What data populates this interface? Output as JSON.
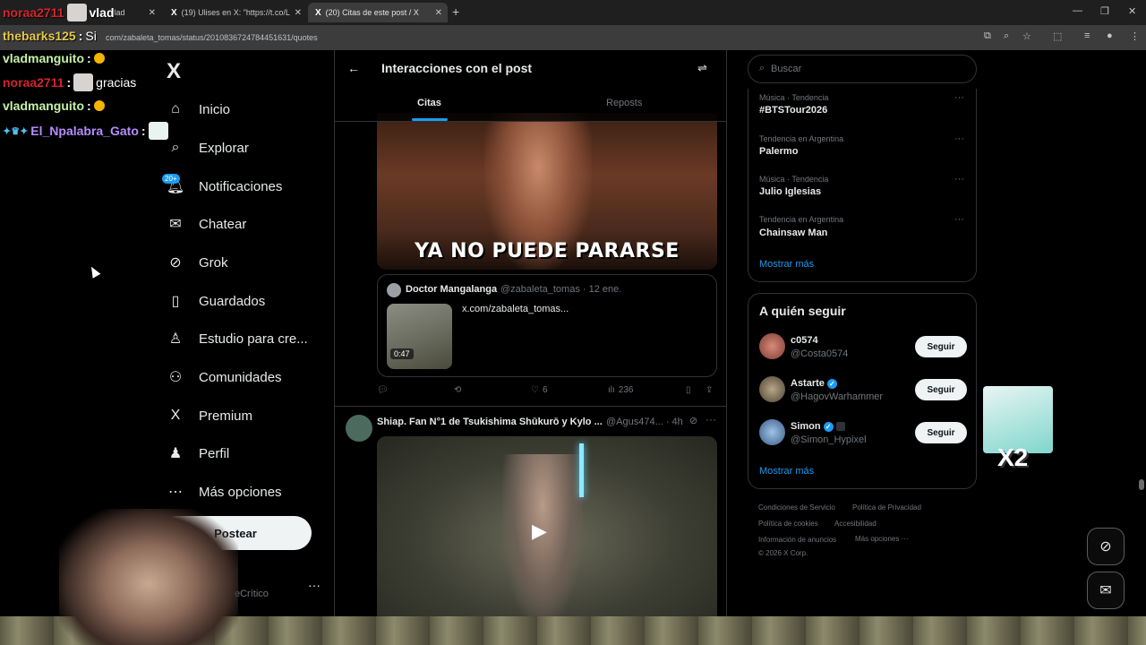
{
  "browser": {
    "tabs": [
      {
        "label": "vlad",
        "active": false
      },
      {
        "label": "(19) Ulises en X: \"https://t.co/L",
        "active": false
      },
      {
        "label": "(20) Citas de este post / X",
        "active": true
      }
    ],
    "url": "com/zabaleta_tomas/status/2010836724784451631/quotes"
  },
  "chat": [
    {
      "user": "noraa2711",
      "color": "#d6232f",
      "message": "",
      "emote": "vlad-emote"
    },
    {
      "user": "thebarks125",
      "color": "#e6c84a",
      "message": "Si",
      "emote": ""
    },
    {
      "user": "vladmanguito",
      "color": "#c7f1a5",
      "message": "",
      "emote": "mango"
    },
    {
      "user": "noraa2711",
      "color": "#d6232f",
      "message": "gracias",
      "emote": "vlad-emote"
    },
    {
      "user": "vladmanguito",
      "color": "#c7f1a5",
      "message": "",
      "emote": "mango"
    },
    {
      "user": "El_Npalabra_Gato",
      "color": "#b68cff",
      "message": "",
      "emote": "cat-emote"
    }
  ],
  "nav": {
    "items": [
      "Inicio",
      "Explorar",
      "Notificaciones",
      "Chatear",
      "Grok",
      "Guardados",
      "Estudio para cre...",
      "Comunidades",
      "Premium",
      "Perfil",
      "Más opciones"
    ],
    "icons": [
      "home-icon",
      "search-icon",
      "bell-icon",
      "mail-icon",
      "grok-icon",
      "bookmark-icon",
      "studio-icon",
      "communities-icon",
      "x-premium-icon",
      "person-icon",
      "more-circle-icon"
    ],
    "notif_badge": "20+",
    "post_button": "Postear",
    "account_name": "eCrítico"
  },
  "main": {
    "title": "Interacciones con el post",
    "tabs": [
      "Citas",
      "Reposts"
    ],
    "gif_caption": "YA NO PUEDE PARARSE",
    "quoted": {
      "name": "Doctor Mangalanga",
      "handle": "@zabaleta_tomas · 12 ene.",
      "link": "x.com/zabaleta_tomas...",
      "duration": "0:47"
    },
    "actions": {
      "likes": "6",
      "views": "236"
    },
    "post2": {
      "name": "Shiap. Fan N°1 de Tsukishima Shūkurō y Kylo ...",
      "handle": "@Agus474... · 4h"
    }
  },
  "sidebar": {
    "search_placeholder": "Buscar",
    "trends": [
      {
        "category": "Música · Tendencia",
        "name": "#BTSTour2026"
      },
      {
        "category": "Tendencia en Argentina",
        "name": "Palermo"
      },
      {
        "category": "Música · Tendencia",
        "name": "Julio Iglesias"
      },
      {
        "category": "Tendencia en Argentina",
        "name": "Chainsaw Man"
      }
    ],
    "show_more": "Mostrar más",
    "follow_title": "A quién seguir",
    "follow": [
      {
        "name": "c0574",
        "handle": "@Costa0574",
        "verified": false,
        "button": "Seguir"
      },
      {
        "name": "Astarte",
        "handle": "@HagovWarhammer",
        "verified": true,
        "button": "Seguir"
      },
      {
        "name": "Simon",
        "handle": "@Simon_Hypixel",
        "verified": true,
        "button": "Seguir"
      }
    ],
    "footer": [
      "Condiciones de Servicio",
      "Política de Privacidad",
      "Política de cookies",
      "Accesibilidad",
      "Información de anuncios",
      "Más opciones ···",
      "© 2026 X Corp."
    ]
  },
  "overlay": {
    "sticker_text": "X2"
  }
}
